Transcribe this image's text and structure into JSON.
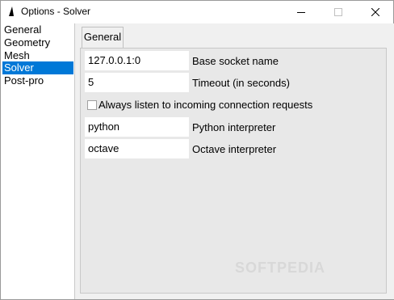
{
  "window": {
    "title": "Options - Solver",
    "icons": {
      "app": "gmsh-icon",
      "minimize": "minimize-icon",
      "maximize": "maximize-icon",
      "close": "close-icon"
    }
  },
  "sidebar": {
    "items": [
      {
        "label": "General",
        "selected": false
      },
      {
        "label": "Geometry",
        "selected": false
      },
      {
        "label": "Mesh",
        "selected": false
      },
      {
        "label": "Solver",
        "selected": true
      },
      {
        "label": "Post-pro",
        "selected": false
      }
    ]
  },
  "tabs": [
    {
      "label": "General",
      "active": true
    }
  ],
  "form": {
    "socket": {
      "value": "127.0.0.1:0",
      "label": "Base socket name"
    },
    "timeout": {
      "value": "5",
      "label": "Timeout (in seconds)"
    },
    "listen": {
      "label": "Always listen to incoming connection requests",
      "checked": false
    },
    "python": {
      "value": "python",
      "label": "Python interpreter"
    },
    "octave": {
      "value": "octave",
      "label": "Octave interpreter"
    }
  },
  "watermark": "SOFTPEDIA",
  "colors": {
    "selection": "#0078d7",
    "panel": "#f0f0f0"
  }
}
